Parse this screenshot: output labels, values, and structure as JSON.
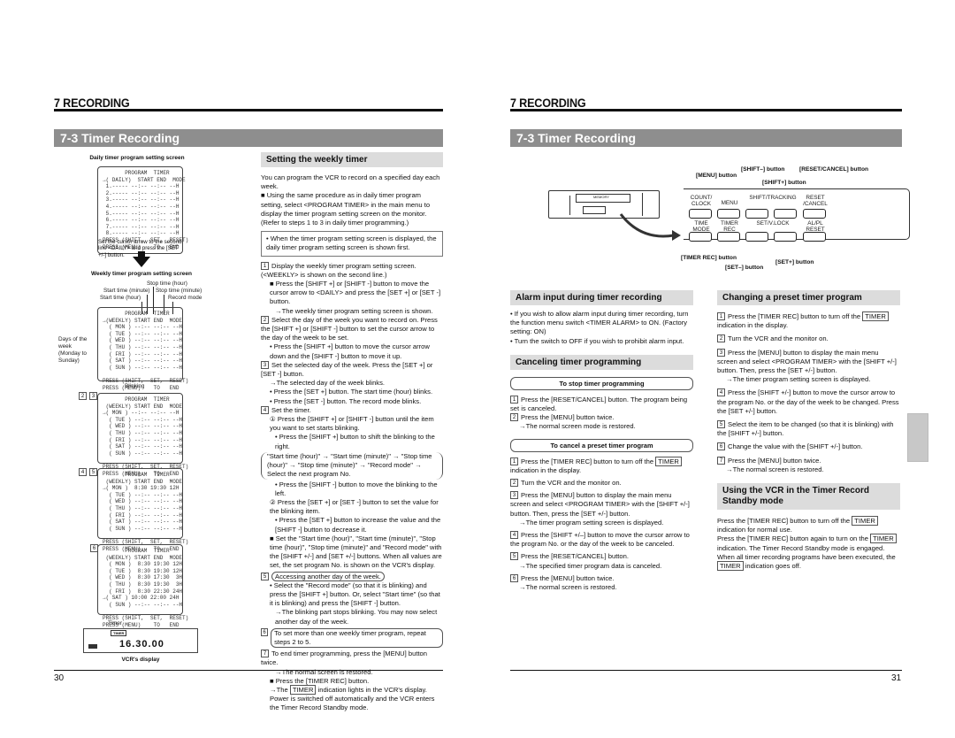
{
  "left_page": {
    "chapter": "7  RECORDING",
    "section": "7-3  Timer Recording",
    "page_number": "30",
    "daily_screen": {
      "caption": "Daily timer program setting screen",
      "lines": [
        "       PROGRAM  TIMER",
        "→( DAILY)  START END  MODE",
        " 1.----- --:-- --:-- --H",
        " 2.----- --:-- --:-- --H",
        " 3.----- --:-- --:-- --H",
        " 4.----- --:-- --:-- --H",
        " 5.----- --:-- --:-- --H",
        " 6.----- --:-- --:-- --H",
        " 7.----- --:-- --:-- --H",
        " 8.----- --:-- --:-- --H",
        "PRESS (SHIFT,  SET,  RESET)",
        "PRESS (MENU)    TO   END"
      ],
      "note": "Set the cursor arrow to the second line <DAILY> and press the [SET +/-] button."
    },
    "weekly_screen": {
      "caption": "Weekly timer program setting screen",
      "labels": {
        "stop_hour": "Stop time (hour)",
        "start_minute": "Start time (minute)",
        "stop_minute": "Stop time (minute)",
        "start_hour": "Start time (hour)",
        "record_mode": "Record mode",
        "days": "Days of the week (Monday to Sunday)"
      },
      "lines": [
        "       PROGRAM  TIMER",
        "→(WEEKLY) START END  MODE",
        "  ( MON ) --:-- --:-- --H",
        "  ( TUE ) --:-- --:-- --H",
        "  ( WED ) --:-- --:-- --H",
        "  ( THU ) --:-- --:-- --H",
        "  ( FRI ) --:-- --:-- --H",
        "  ( SAT ) --:-- --:-- --H",
        "  ( SUN ) --:-- --:-- --H",
        "",
        "PRESS (SHIFT,  SET,  RESET)",
        "PRESS (MENU)    TO   END"
      ]
    },
    "blinking_label": "Blinking",
    "screen_23": {
      "steps": [
        "2",
        "3"
      ],
      "lines": [
        "       PROGRAM  TIMER",
        " (WEEKLY) START END  MODE",
        "→( MON ) --:-- --:-- --H",
        "  ( TUE ) --:-- --:-- --H",
        "  ( WED ) --:-- --:-- --H",
        "  ( THU ) --:-- --:-- --H",
        "  ( FRI ) --:-- --:-- --H",
        "  ( SAT ) --:-- --:-- --H",
        "  ( SUN ) --:-- --:-- --H",
        "",
        "PRESS (SHIFT,  SET,  RESET)",
        "PRESS (MENU)    TO   END"
      ]
    },
    "screen_45": {
      "steps": [
        "4",
        "5"
      ],
      "lines": [
        "       PROGRAM  TIMER",
        " (WEEKLY) START END  MODE",
        "→( MON )  8:30 19:30 12H",
        "  ( TUE ) --:-- --:-- --H",
        "  ( WED ) --:-- --:-- --H",
        "  ( THU ) --:-- --:-- --H",
        "  ( FRI ) --:-- --:-- --H",
        "  ( SAT ) --:-- --:-- --H",
        "  ( SUN ) --:-- --:-- --H",
        "",
        "PRESS (SHIFT,  SET,  RESET)",
        "PRESS (MENU)    TO   END"
      ]
    },
    "screen_6": {
      "steps": [
        "6"
      ],
      "lines": [
        "       PROGRAM  TIMER",
        " (WEEKLY) START END  MODE",
        "  ( MON )  8:30 19:30 12H",
        "  ( TUE )  8:30 19:30 12H",
        "  ( WED )  8:30 17:30  3H",
        "  ( THU )  8:30 19:30  3H",
        "  ( FRI )  8:30 22:30 24H",
        "→( SAT ) 10:00 22:00 24H",
        "  ( SUN ) --:-- --:-- --H",
        "",
        "PRESS (SHIFT,  SET,  RESET)",
        "PRESS (MENU)    TO   END"
      ]
    },
    "vcr_display": {
      "timer_label": "Timer",
      "timer_badge": "TIMER",
      "time": "16.30.00",
      "caption": "VCR's display"
    },
    "weekly": {
      "heading": "Setting the weekly timer",
      "intro": "You can program the VCR to record on a specified day each week.",
      "bullet1": "■ Using the same procedure as in daily timer program setting, select <PROGRAM TIMER> in the main menu to display the timer program setting screen on the monitor. (Refer to steps 1 to 3 in daily timer programming.)",
      "note": "• When the timer program setting screen is displayed, the daily timer program setting screen is shown first.",
      "s1": "Display the weekly timer program setting screen. (<WEEKLY> is shown on the second line.)",
      "s1a": "■ Press the [SHIFT +] or [SHIFT -] button to move the cursor arrow to <DAILY> and press the [SET +] or [SET -] button.",
      "s1b": "→The weekly timer program setting screen is shown.",
      "s2": "Select the day of the week you want to record on. Press the [SHIFT +] or [SHIFT -] button to set the cursor arrow to the day of the week to be set.",
      "s2a": "• Press the [SHIFT +] button to move the cursor arrow down and the [SHIFT -] button to move it up.",
      "s3": "Set the selected day of the week. Press the [SET +] or [SET -] button.",
      "s3a": "→The selected day of the week blinks.",
      "s3b": "• Press the [SET +] button. The start time (hour) blinks.",
      "s3c": "• Press the [SET -] button. The record mode blinks.",
      "s4": "Set the timer.",
      "s4a": "① Press the [SHIFT +] or [SHIFT -] button until the item you want to set starts blinking.",
      "s4b": "• Press the [SHIFT +] button to shift the blinking to the right.",
      "s4seq": "\"Start time (hour)\" → \"Start time (minute)\" → \"Stop time (hour)\" → \"Stop time (minute)\" → \"Record mode\" → Select the next program No.",
      "s4c": "• Press the [SHIFT -] button to move the blinking to the left.",
      "s4d": "② Press the [SET +] or [SET -] button to set the value for the blinking item.",
      "s4e": "• Press the [SET +] button to increase the value and the [SHIFT -] button to decrease it.",
      "s4f": "■ Set the \"Start time (hour)\", \"Start time (minute)\", \"Stop time (hour)\", \"Stop time (minute)\" and \"Record mode\" with the [SHIFT +/-] and [SET +/-] buttons. When all values are set, the set program No. is shown on the VCR's display.",
      "s5": "Accessing another day of the week.",
      "s5a": "• Select the \"Record mode\" (so that it is blinking) and press the [SHIFT +] button. Or, select \"Start time\" (so that it is blinking) and press the [SHIFT -] button.",
      "s5b": "→The blinking part stops blinking. You may now select another day of the week.",
      "s6": "To set more than one weekly timer program, repeat steps 2 to 5.",
      "s7": "To end timer programming, press the [MENU] button twice.",
      "s7a": "→The normal screen is restored.",
      "s7b": "■ Press the [TIMER REC] button.",
      "s7c_pre": "→The",
      "s7c_badge": "TIMER",
      "s7c_post": "indication lights in the VCR's display. Power is switched off automatically and the VCR enters the Timer Record Standby mode."
    }
  },
  "right_page": {
    "chapter": "7  RECORDING",
    "section": "7-3  Timer Recording",
    "page_number": "31",
    "panel": {
      "callouts": {
        "menu": "[MENU] button",
        "shift_minus": "[SHIFT–] button",
        "shift_plus": "[SHIFT+] button",
        "reset_cancel": "[RESET/CANCEL] button",
        "timer_rec": "[TIMER REC] button",
        "set_minus": "[SET–] button",
        "set_plus": "[SET+] button"
      },
      "buttons_top": [
        "COUNT/ CLOCK",
        "MENU",
        "–",
        "+",
        "RESET /CANCEL"
      ],
      "group_top": "SHIFT/TRACKING",
      "buttons_bottom": [
        "TIME MODE",
        "TIMER REC",
        "–",
        "+",
        "AL/PL RESET"
      ],
      "group_bottom": "SET/V.LOCK",
      "vcr_brand": "MEMORY"
    },
    "alarm": {
      "heading": "Alarm input during timer recording",
      "b1": "• If you wish to allow alarm input during timer recording, turn the function menu switch <TIMER ALARM> to ON. (Factory setting: ON)",
      "b2": "• Turn the switch to OFF if you wish to prohibit alarm input."
    },
    "cancel": {
      "heading": "Canceling timer programming",
      "stop_title": "To stop timer programming",
      "stop_steps": [
        "Press the [RESET/CANCEL] button. The program being set is canceled.",
        "Press the [MENU] button twice."
      ],
      "stop_result": "→The normal screen mode is restored.",
      "preset_title": "To cancel a preset timer program",
      "p1_pre": "Press the [TIMER REC] button to turn off the",
      "p1_post": "indication in the display.",
      "badge": "TIMER",
      "p2": "Turn the VCR and the monitor on.",
      "p3": "Press the [MENU] button to display the main menu screen and select <PROGRAM TIMER> with the [SHIFT +/-] button.  Then, press the [SET +/-] button.",
      "p3a": "→The timer program setting screen is displayed.",
      "p4": "Press the [SHIFT +/–] button to move the cursor arrow to the program No. or the day of the week to be canceled.",
      "p5": "Press the [RESET/CANCEL] button.",
      "p5a": "→The specified timer program data is canceled.",
      "p6": "Press the [MENU] button twice.",
      "p6a": "→The normal screen is restored."
    },
    "change": {
      "heading": "Changing a preset timer program",
      "c1_pre": "Press the [TIMER REC] button to turn off the",
      "c1_post": "indication in the display.",
      "badge": "TIMER",
      "c2": "Turn the VCR and the monitor on.",
      "c3": "Press the [MENU] button to display the main menu screen and select <PROGRAM TIMER> with the [SHIFT +/-] button.  Then, press the [SET +/-] button.",
      "c3a": "→The timer program setting screen is displayed.",
      "c4": "Press the [SHIFT +/-] button to move the cursor arrow to the program No. or the day of the week to be changed. Press the [SET +/-] button.",
      "c5": "Select the item to be changed (so that it is blinking) with the [SHIFT +/-] button.",
      "c6": "Change the value with the [SHIFT +/-] button.",
      "c7": "Press the [MENU] button twice.",
      "c7a": "→The normal screen is restored."
    },
    "standby": {
      "heading": "Using the VCR in the Timer Record Standby mode",
      "l1_pre": "Press the [TIMER REC] button to turn off the",
      "l1_post": "indication for normal use.",
      "l2_pre": "Press the [TIMER REC] button again to turn on the",
      "l2_post": "indication.  The Timer Record Standby mode is engaged. When all timer recording programs have been executed, the",
      "l3_post": "indication goes off.",
      "badge": "TIMER"
    }
  },
  "step_numbers": [
    "1",
    "2",
    "3",
    "4",
    "5",
    "6",
    "7"
  ]
}
